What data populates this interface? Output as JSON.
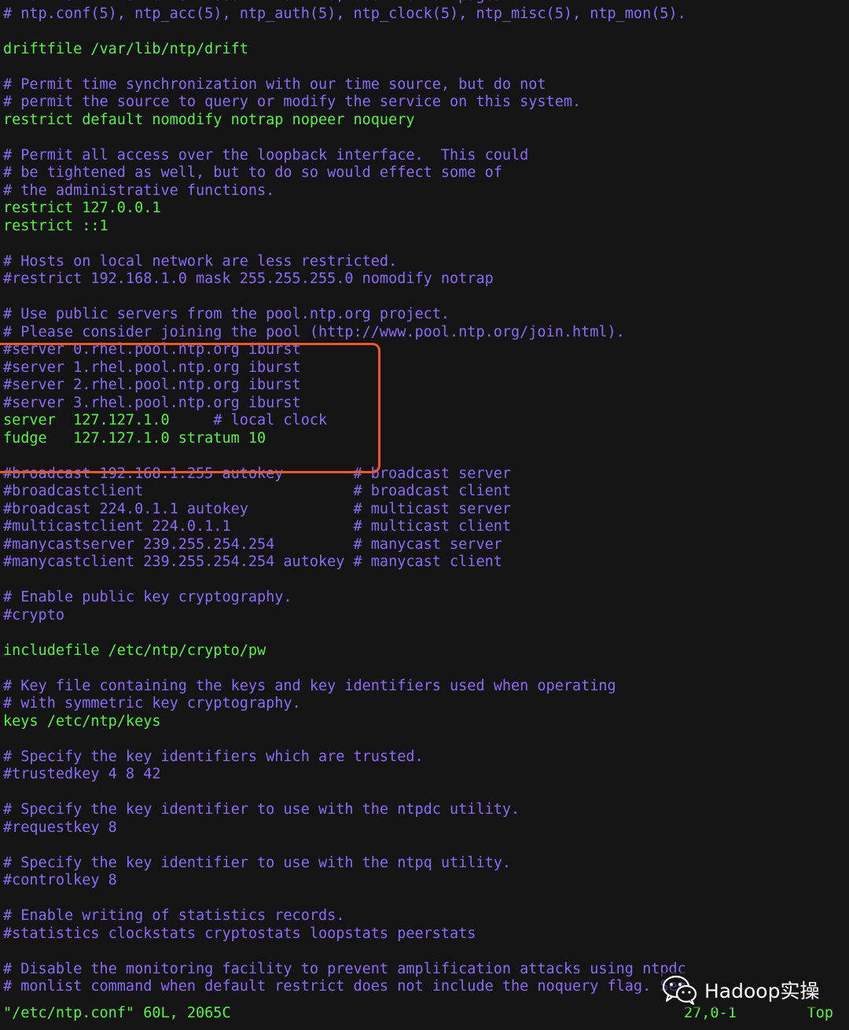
{
  "colors": {
    "background": "#141414",
    "comment": "#8a6cf6",
    "code": "#59f243",
    "highlight_border": "#f2552c",
    "watermark_text": "#ffffff"
  },
  "lines": [
    {
      "text": "# For more information about this file, see the man pages",
      "type": "comment"
    },
    {
      "text": "# ntp.conf(5), ntp_acc(5), ntp_auth(5), ntp_clock(5), ntp_misc(5), ntp_mon(5).",
      "type": "comment"
    },
    {
      "text": "",
      "type": "blank"
    },
    {
      "text": "driftfile /var/lib/ntp/drift",
      "type": "code"
    },
    {
      "text": "",
      "type": "blank"
    },
    {
      "text": "# Permit time synchronization with our time source, but do not",
      "type": "comment"
    },
    {
      "text": "# permit the source to query or modify the service on this system.",
      "type": "comment"
    },
    {
      "text": "restrict default nomodify notrap nopeer noquery",
      "type": "code"
    },
    {
      "text": "",
      "type": "blank"
    },
    {
      "text": "# Permit all access over the loopback interface.  This could",
      "type": "comment"
    },
    {
      "text": "# be tightened as well, but to do so would effect some of",
      "type": "comment"
    },
    {
      "text": "# the administrative functions.",
      "type": "comment"
    },
    {
      "text": "restrict 127.0.0.1",
      "type": "code"
    },
    {
      "text": "restrict ::1",
      "type": "code"
    },
    {
      "text": "",
      "type": "blank"
    },
    {
      "text": "# Hosts on local network are less restricted.",
      "type": "comment"
    },
    {
      "text": "#restrict 192.168.1.0 mask 255.255.255.0 nomodify notrap",
      "type": "comment"
    },
    {
      "text": "",
      "type": "blank"
    },
    {
      "text": "# Use public servers from the pool.ntp.org project.",
      "type": "comment"
    },
    {
      "text": "# Please consider joining the pool (http://www.pool.ntp.org/join.html).",
      "type": "comment"
    },
    {
      "text": "#server 0.rhel.pool.ntp.org iburst",
      "type": "comment"
    },
    {
      "text": "#server 1.rhel.pool.ntp.org iburst",
      "type": "comment"
    },
    {
      "text": "#server 2.rhel.pool.ntp.org iburst",
      "type": "comment"
    },
    {
      "text": "#server 3.rhel.pool.ntp.org iburst",
      "type": "comment"
    },
    {
      "text": "server  127.127.1.0     # local clock",
      "type": "mixed",
      "code_part": "server  127.127.1.0     ",
      "comment_part": "# local clock"
    },
    {
      "text": "fudge   127.127.1.0 stratum 10",
      "type": "code"
    },
    {
      "text": "",
      "type": "blank"
    },
    {
      "text": "#broadcast 192.168.1.255 autokey        # broadcast server",
      "type": "comment"
    },
    {
      "text": "#broadcastclient                        # broadcast client",
      "type": "comment"
    },
    {
      "text": "#broadcast 224.0.1.1 autokey            # multicast server",
      "type": "comment"
    },
    {
      "text": "#multicastclient 224.0.1.1              # multicast client",
      "type": "comment"
    },
    {
      "text": "#manycastserver 239.255.254.254         # manycast server",
      "type": "comment"
    },
    {
      "text": "#manycastclient 239.255.254.254 autokey # manycast client",
      "type": "comment"
    },
    {
      "text": "",
      "type": "blank"
    },
    {
      "text": "# Enable public key cryptography.",
      "type": "comment"
    },
    {
      "text": "#crypto",
      "type": "comment"
    },
    {
      "text": "",
      "type": "blank"
    },
    {
      "text": "includefile /etc/ntp/crypto/pw",
      "type": "code"
    },
    {
      "text": "",
      "type": "blank"
    },
    {
      "text": "# Key file containing the keys and key identifiers used when operating",
      "type": "comment"
    },
    {
      "text": "# with symmetric key cryptography.",
      "type": "comment"
    },
    {
      "text": "keys /etc/ntp/keys",
      "type": "code"
    },
    {
      "text": "",
      "type": "blank"
    },
    {
      "text": "# Specify the key identifiers which are trusted.",
      "type": "comment"
    },
    {
      "text": "#trustedkey 4 8 42",
      "type": "comment"
    },
    {
      "text": "",
      "type": "blank"
    },
    {
      "text": "# Specify the key identifier to use with the ntpdc utility.",
      "type": "comment"
    },
    {
      "text": "#requestkey 8",
      "type": "comment"
    },
    {
      "text": "",
      "type": "blank"
    },
    {
      "text": "# Specify the key identifier to use with the ntpq utility.",
      "type": "comment"
    },
    {
      "text": "#controlkey 8",
      "type": "comment"
    },
    {
      "text": "",
      "type": "blank"
    },
    {
      "text": "# Enable writing of statistics records.",
      "type": "comment"
    },
    {
      "text": "#statistics clockstats cryptostats loopstats peerstats",
      "type": "comment"
    },
    {
      "text": "",
      "type": "blank"
    },
    {
      "text": "# Disable the monitoring facility to prevent amplification attacks using ntpdc",
      "type": "comment"
    },
    {
      "text": "# monlist command when default restrict does not include the noquery flag. See",
      "type": "comment"
    }
  ],
  "status": {
    "file_info": "\"/etc/ntp.conf\" 60L, 2065C",
    "cursor_position": "27,0-1",
    "scroll_position": "Top"
  },
  "watermark": {
    "icon": "wechat-icon",
    "text": "Hadoop实操"
  }
}
